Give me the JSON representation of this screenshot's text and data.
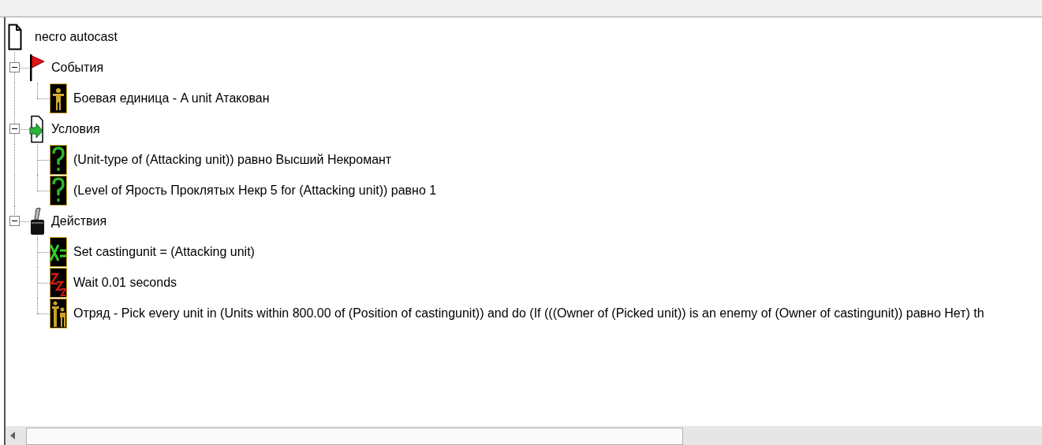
{
  "tree": {
    "label": "necro autocast",
    "kind": "trigger",
    "children": [
      {
        "label": "События",
        "kind": "events",
        "expanded": true,
        "children": [
          {
            "label": "Боевая единица - A unit Атакован",
            "kind": "unit"
          }
        ]
      },
      {
        "label": "Условия",
        "kind": "conditions",
        "expanded": true,
        "children": [
          {
            "label": "(Unit-type of (Attacking unit)) равно Высший Некромант",
            "kind": "condition"
          },
          {
            "label": "(Level of Ярость Проклятых Некр 5 for (Attacking unit)) равно 1",
            "kind": "condition"
          }
        ]
      },
      {
        "label": "Действия",
        "kind": "actions",
        "expanded": true,
        "children": [
          {
            "label": "Set castingunit = (Attacking unit)",
            "kind": "set-variable"
          },
          {
            "label": "Wait 0.01 seconds",
            "kind": "wait"
          },
          {
            "label": "Отряд - Pick every unit in (Units within 800.00 of (Position of castingunit)) and do (If (((Owner of (Picked unit)) is an enemy of (Owner of castingunit)) равно Нет) th",
            "kind": "group"
          }
        ]
      }
    ]
  }
}
